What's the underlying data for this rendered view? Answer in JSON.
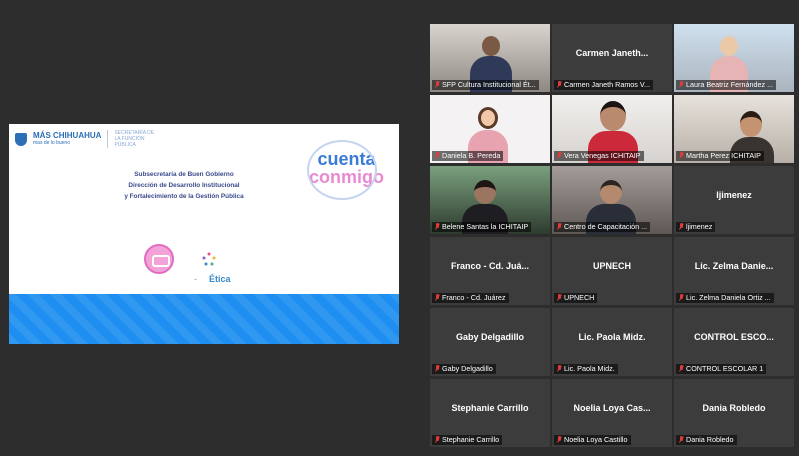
{
  "slide": {
    "logo_main": "MÁS CHIHUAHUA",
    "logo_sub": "mas de lo bueno",
    "logo_secretaria": "SECRETARÍA DE LA FUNCIÓN PÚBLICA",
    "line1": "Subsecretaría de Buen Gobierno",
    "line2": "Dirección de Desarrollo Institucional",
    "line3": "y Fortalecimiento de la Gestión Pública",
    "brand_a": "cuenta",
    "brand_b": "conmigo",
    "etica_dash": "-",
    "etica": "Ética"
  },
  "participants": [
    {
      "name": "",
      "label": "SFP Cultura Institucional Ét...",
      "video": true,
      "active": true
    },
    {
      "name": "Carmen Janeth...",
      "label": "Carmen Janeth Ramos V...",
      "video": false
    },
    {
      "name": "",
      "label": "Laura Beatriz Fernández ...",
      "video": true
    },
    {
      "name": "",
      "label": "Daniela B. Pereda",
      "video": true
    },
    {
      "name": "",
      "label": "Vera Venegas ICHITAIP",
      "video": true
    },
    {
      "name": "",
      "label": "Martha Perez ICHITAIP",
      "video": true
    },
    {
      "name": "",
      "label": "Belene Santas la ICHITAIP",
      "video": true
    },
    {
      "name": "",
      "label": "Centro de Capacitación ...",
      "video": true
    },
    {
      "name": "ljimenez",
      "label": "ljimenez",
      "video": false
    },
    {
      "name": "Franco - Cd. Juá...",
      "label": "Franco - Cd. Juárez",
      "video": false
    },
    {
      "name": "UPNECH",
      "label": "UPNECH",
      "video": false
    },
    {
      "name": "Lic. Zelma Danie...",
      "label": "Lic. Zelma Daniela Ortiz ...",
      "video": false
    },
    {
      "name": "Gaby Delgadillo",
      "label": "Gaby Delgadillo",
      "video": false
    },
    {
      "name": "Lic. Paola Midz.",
      "label": "Lic. Paola Midz.",
      "video": false
    },
    {
      "name": "CONTROL ESCO...",
      "label": "CONTROL ESCOLAR 1",
      "video": false
    },
    {
      "name": "Stephanie Carrillo",
      "label": "Stephanie Carrillo",
      "video": false
    },
    {
      "name": "Noelia Loya Cas...",
      "label": "Noelia Loya Castillo",
      "video": false
    },
    {
      "name": "Dania Robledo",
      "label": "Dania Robledo",
      "video": false
    }
  ],
  "icons": {
    "muted": "mic-off-icon"
  },
  "colors": {
    "background": "#2d2d2d",
    "tile": "#3c3c3c",
    "active_border": "#e6e94c",
    "muted_icon": "#e03b3b",
    "slide_band": "#1e8ff0"
  }
}
